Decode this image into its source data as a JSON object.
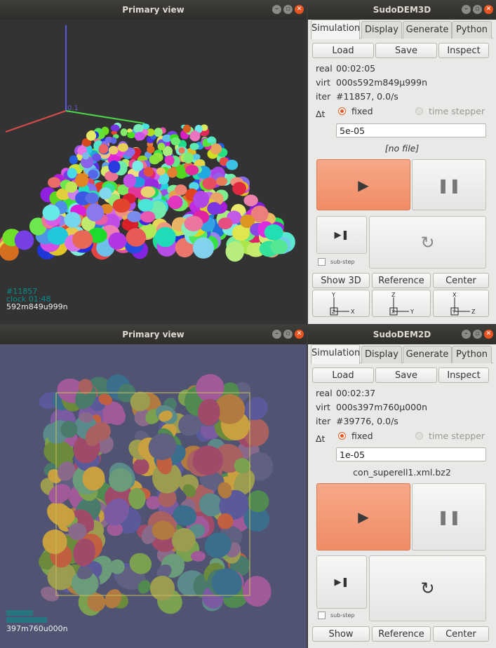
{
  "top_view": {
    "title": "Primary view",
    "axis_label": "0.1",
    "hud": {
      "iter": "#11857",
      "clock": "clock 01:48",
      "virt": "592m849u999n"
    }
  },
  "top_ctrl": {
    "title": "SudoDEM3D",
    "tabs": [
      "Simulation",
      "Display",
      "Generate",
      "Python"
    ],
    "load": "Load",
    "save": "Save",
    "inspect": "Inspect",
    "real_label": "real",
    "real": "00:02:05",
    "virt_label": "virt",
    "virt": "000s592m849μ999n",
    "iter_label": "iter",
    "iter": "#11857, 0.0/s",
    "dt_label": "Δt",
    "fixed": "fixed",
    "time_stepper": "time stepper",
    "dt_value": "5e-05",
    "file": "[no file]",
    "substep": "sub-step",
    "show": "Show 3D",
    "reference": "Reference",
    "center": "Center",
    "axes": [
      {
        "up": "Y",
        "right": "X",
        "box": "Z"
      },
      {
        "up": "Z",
        "right": "Y",
        "box": "X"
      },
      {
        "up": "X",
        "right": "Z",
        "box": "Y"
      }
    ]
  },
  "bottom_view": {
    "title": "Primary view",
    "hud": {
      "virt": "397m760u000n"
    }
  },
  "bottom_ctrl": {
    "title": "SudoDEM2D",
    "tabs": [
      "Simulation",
      "Display",
      "Generate",
      "Python"
    ],
    "load": "Load",
    "save": "Save",
    "inspect": "Inspect",
    "real_label": "real",
    "real": "00:02:37",
    "virt_label": "virt",
    "virt": "000s397m760μ000n",
    "iter_label": "iter",
    "iter": "#39776, 0.0/s",
    "dt_label": "Δt",
    "fixed": "fixed",
    "time_stepper": "time stepper",
    "dt_value": "1e-05",
    "file": "con_superell1.xml.bz2",
    "substep": "sub-step",
    "show": "Show",
    "reference": "Reference",
    "center": "Center"
  }
}
